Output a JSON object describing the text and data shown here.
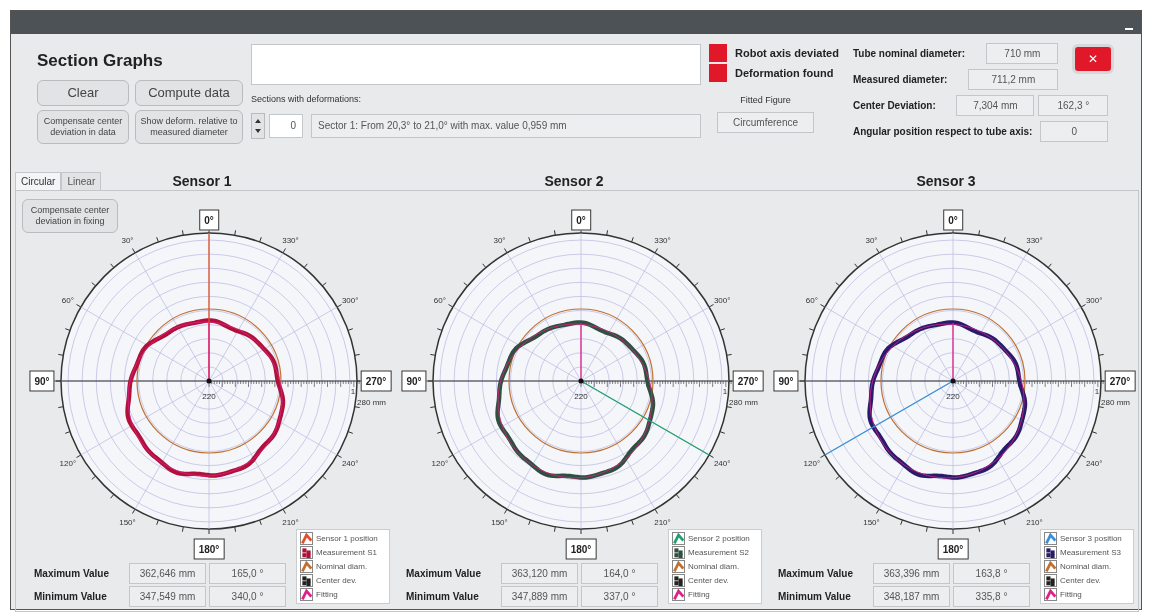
{
  "header": {
    "title": "Section Graphs",
    "buttons": [
      {
        "label": "Clear",
        "kind": "large"
      },
      {
        "label": "Compute data",
        "kind": "large"
      },
      {
        "label": "Compensate center deviation in data",
        "kind": "small"
      },
      {
        "label": "Show deform. relative to measured diameter",
        "kind": "small"
      }
    ]
  },
  "sections": {
    "label": "Sections with deformations:",
    "index": "0",
    "value": "Sector 1: From 20,3° to 21,0° with max. value 0,959 mm"
  },
  "indicators": [
    {
      "label": "Robot axis deviated",
      "on": true
    },
    {
      "label": "Deformation found",
      "on": true
    }
  ],
  "fitted_figure": {
    "label": "Fitted Figure",
    "value": "Circumference"
  },
  "measures": [
    {
      "label": "Tube nominal diameter:",
      "values": [
        "710 mm"
      ]
    },
    {
      "label": "Measured diameter:",
      "values": [
        "711,2 mm"
      ]
    },
    {
      "label": "Center Deviation:",
      "values": [
        "7,304 mm",
        "162,3 °"
      ]
    },
    {
      "label": "Angular position respect to tube axis:",
      "values": [
        "0"
      ]
    }
  ],
  "close_button": {
    "label": "✕"
  },
  "tabs": [
    {
      "label": "Circular",
      "selected": true
    },
    {
      "label": "Linear",
      "selected": false
    }
  ],
  "compensate_button": {
    "label": "Compensate center deviation in fixing"
  },
  "sensors": [
    {
      "title": "Sensor 1",
      "axis_labels": [
        "0°",
        "90°",
        "180°",
        "270°"
      ],
      "angle_labels": [
        "30°",
        "60°",
        "120°",
        "150°",
        "210°",
        "240°",
        "300°",
        "330°"
      ],
      "scale_labels": [
        "220",
        "1",
        "280 mm"
      ],
      "legend": [
        {
          "label": "Sensor 1 position",
          "kind": "line",
          "color": "#e0502a"
        },
        {
          "label": "Measurement S1",
          "kind": "points",
          "color": "#b0103a"
        },
        {
          "label": "Nominal diam.",
          "kind": "line",
          "color": "#c07030"
        },
        {
          "label": "Center dev.",
          "kind": "points",
          "color": "#222222"
        },
        {
          "label": "Fitting",
          "kind": "line",
          "color": "#e0208a"
        }
      ],
      "stats": [
        {
          "label": "Maximum Value",
          "values": [
            "362,646 mm",
            "165,0 °"
          ]
        },
        {
          "label": "Minimum Value",
          "values": [
            "347,549 mm",
            "340,0 °"
          ]
        }
      ]
    },
    {
      "title": "Sensor 2",
      "axis_labels": [
        "0°",
        "90°",
        "180°",
        "270°"
      ],
      "angle_labels": [
        "30°",
        "60°",
        "120°",
        "150°",
        "210°",
        "240°",
        "300°",
        "330°"
      ],
      "scale_labels": [
        "220",
        "1",
        "280 mm"
      ],
      "legend": [
        {
          "label": "Sensor 2 position",
          "kind": "line",
          "color": "#20a070"
        },
        {
          "label": "Measurement S2",
          "kind": "points",
          "color": "#2f4f3f"
        },
        {
          "label": "Nominal diam.",
          "kind": "line",
          "color": "#c07030"
        },
        {
          "label": "Center dev.",
          "kind": "points",
          "color": "#222222"
        },
        {
          "label": "Fitting",
          "kind": "line",
          "color": "#e0208a"
        }
      ],
      "stats": [
        {
          "label": "Maximum Value",
          "values": [
            "363,120 mm",
            "164,0 °"
          ]
        },
        {
          "label": "Minimum Value",
          "values": [
            "347,889 mm",
            "337,0 °"
          ]
        }
      ]
    },
    {
      "title": "Sensor 3",
      "axis_labels": [
        "0°",
        "90°",
        "180°",
        "270°"
      ],
      "angle_labels": [
        "30°",
        "60°",
        "120°",
        "150°",
        "210°",
        "240°",
        "300°",
        "330°"
      ],
      "scale_labels": [
        "220",
        "1",
        "280 mm"
      ],
      "legend": [
        {
          "label": "Sensor 3 position",
          "kind": "line",
          "color": "#3a90d8"
        },
        {
          "label": "Measurement S3",
          "kind": "points",
          "color": "#2a1a6a"
        },
        {
          "label": "Nominal diam.",
          "kind": "line",
          "color": "#c07030"
        },
        {
          "label": "Center dev.",
          "kind": "points",
          "color": "#222222"
        },
        {
          "label": "Fitting",
          "kind": "line",
          "color": "#e0208a"
        }
      ],
      "stats": [
        {
          "label": "Maximum Value",
          "values": [
            "363,396 mm",
            "163,8 °"
          ]
        },
        {
          "label": "Minimum Value",
          "values": [
            "348,187 mm",
            "335,8 °"
          ]
        }
      ]
    }
  ]
}
